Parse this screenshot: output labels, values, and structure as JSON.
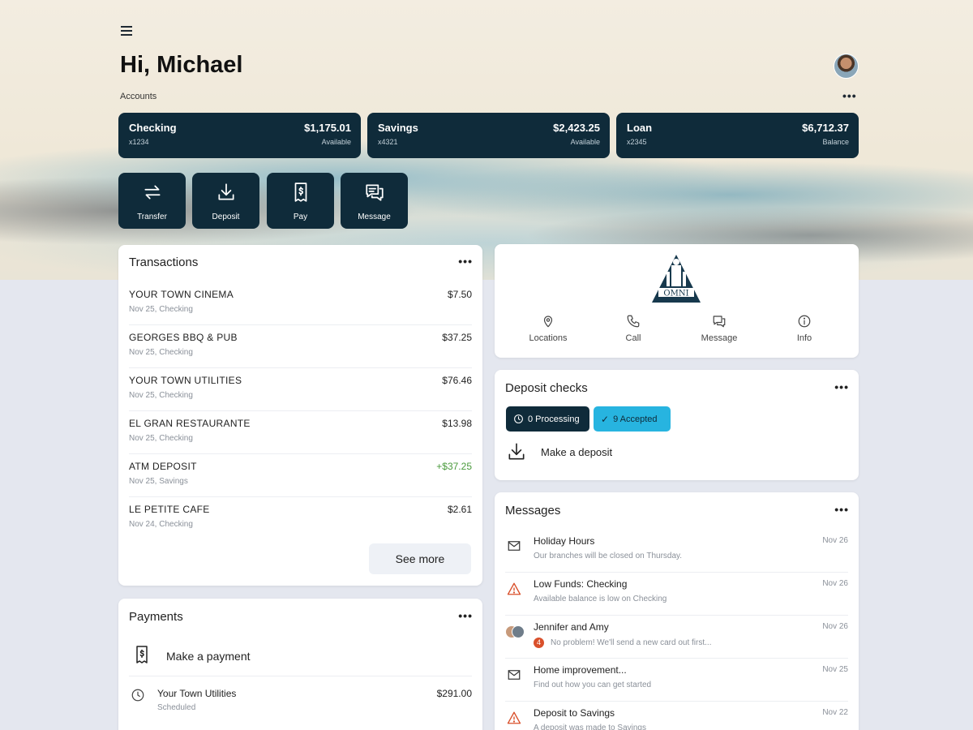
{
  "header": {
    "greeting": "Hi, Michael",
    "accounts_label": "Accounts",
    "more_label": "•••"
  },
  "accounts": [
    {
      "name": "Checking",
      "number": "x1234",
      "balance": "$1,175.01",
      "balance_label": "Available"
    },
    {
      "name": "Savings",
      "number": "x4321",
      "balance": "$2,423.25",
      "balance_label": "Available"
    },
    {
      "name": "Loan",
      "number": "x2345",
      "balance": "$6,712.37",
      "balance_label": "Balance"
    }
  ],
  "actions": [
    {
      "label": "Transfer",
      "icon": "transfer-icon"
    },
    {
      "label": "Deposit",
      "icon": "deposit-icon"
    },
    {
      "label": "Pay",
      "icon": "bill-icon"
    },
    {
      "label": "Message",
      "icon": "message-icon"
    }
  ],
  "transactions": {
    "title": "Transactions",
    "items": [
      {
        "name": "YOUR TOWN CINEMA",
        "sub": "Nov 25, Checking",
        "amount": "$7.50"
      },
      {
        "name": "GEORGES BBQ & PUB",
        "sub": "Nov 25, Checking",
        "amount": "$37.25"
      },
      {
        "name": "YOUR TOWN UTILITIES",
        "sub": "Nov 25, Checking",
        "amount": "$76.46"
      },
      {
        "name": "EL GRAN RESTAURANTE",
        "sub": "Nov 25, Checking",
        "amount": "$13.98"
      },
      {
        "name": "ATM DEPOSIT",
        "sub": "Nov 25, Savings",
        "amount": "+$37.25"
      },
      {
        "name": "LE PETITE CAFE",
        "sub": "Nov 24, Checking",
        "amount": "$2.61"
      }
    ],
    "see_more": "See more"
  },
  "payments": {
    "title": "Payments",
    "make_payment": "Make a payment",
    "scheduled": {
      "name": "Your Town Utilities",
      "status": "Scheduled",
      "amount": "$291.00"
    }
  },
  "bank": {
    "logo_text": "OMNI",
    "links": [
      {
        "label": "Locations",
        "icon": "location-pin-icon"
      },
      {
        "label": "Call",
        "icon": "phone-icon"
      },
      {
        "label": "Message",
        "icon": "chat-icon"
      },
      {
        "label": "Info",
        "icon": "info-icon"
      }
    ]
  },
  "deposit_checks": {
    "title": "Deposit checks",
    "processing": "0 Processing",
    "accepted": "9 Accepted",
    "make_deposit": "Make a deposit"
  },
  "messages": {
    "title": "Messages",
    "items": [
      {
        "title": "Holiday Hours",
        "preview": "Our branches will be closed on Thursday.",
        "date": "Nov 26",
        "icon": "envelope-icon"
      },
      {
        "title": "Low Funds: Checking",
        "preview": "Available balance is low on Checking",
        "date": "Nov 26",
        "icon": "warning-icon"
      },
      {
        "title": "Jennifer and Amy",
        "preview": "No problem! We'll send a new card out first...",
        "date": "Nov 26",
        "icon": "group-avatar-icon",
        "badge": "4"
      },
      {
        "title": "Home improvement...",
        "preview": "Find out how you can get started",
        "date": "Nov 25",
        "icon": "envelope-icon"
      },
      {
        "title": "Deposit to Savings",
        "preview": "A deposit was made to Savings",
        "date": "Nov 22",
        "icon": "warning-icon"
      }
    ]
  },
  "colors": {
    "navy": "#0f2b3a",
    "accent_blue": "#27b4e0",
    "positive_green": "#4a9a3c",
    "warning_orange": "#d9502b",
    "page_bg": "#e4e7ef"
  }
}
